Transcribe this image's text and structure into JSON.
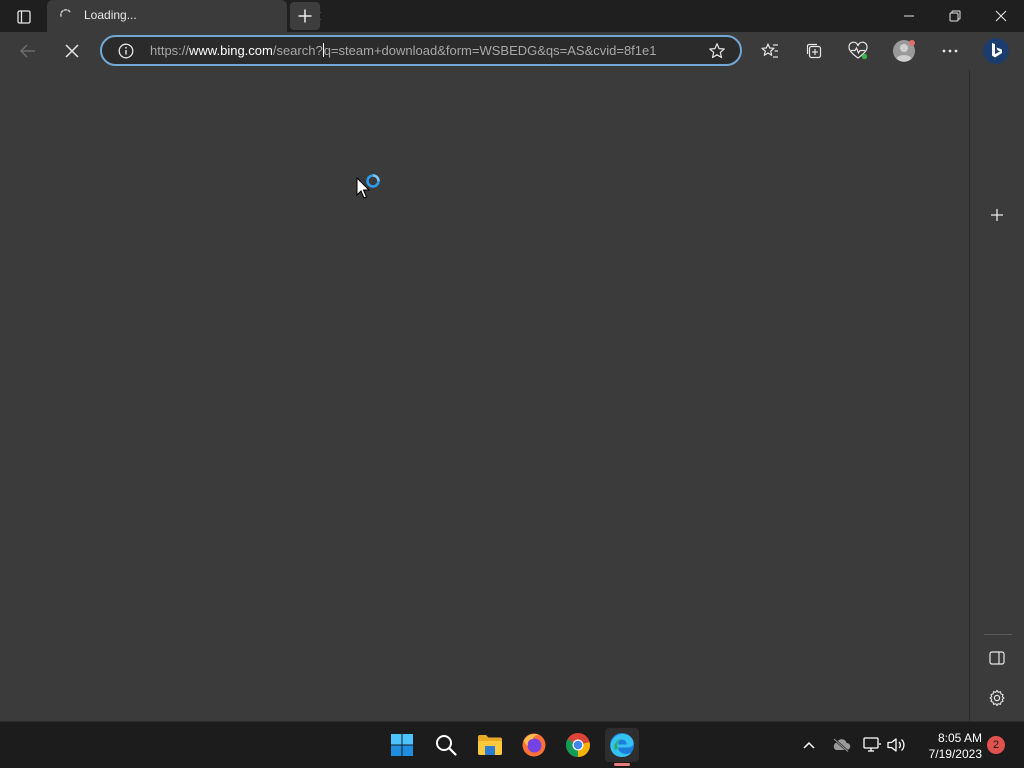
{
  "browser": {
    "tab": {
      "title": "Loading...",
      "state": "loading"
    },
    "address_bar": {
      "url_prefix": "https://",
      "url_host": "www.bing.com",
      "url_path_before_caret": "/search?",
      "url_path_after_caret": "q=steam+download&form=WSBEDG&qs=AS&cvid=8f1e1"
    },
    "toolbar_icons": [
      "back-icon",
      "stop-icon",
      "favorites-icon",
      "collections-icon",
      "browser-essentials-icon",
      "profile-icon",
      "more-icon",
      "bing-copilot-icon"
    ],
    "sidebar_icons": [
      "add-icon",
      "hide-sidebar-icon",
      "settings-icon"
    ]
  },
  "taskbar": {
    "apps": [
      "start-icon",
      "search-icon",
      "file-explorer-icon",
      "firefox-icon",
      "chrome-icon",
      "edge-icon"
    ],
    "active_app": "edge",
    "tray_icons": [
      "chevron-up-icon",
      "onedrive-offline-icon",
      "network-icon",
      "volume-icon"
    ],
    "clock": {
      "time": "8:05 AM",
      "date": "7/19/2023"
    },
    "notifications": "2"
  },
  "colors": {
    "accent": "#73a7d6",
    "chrome_bg": "#1f1f1f",
    "toolbar_bg": "#3b3b3b",
    "content_bg": "#3b3b3b",
    "taskbar_bg": "#1c1c1c",
    "notification_badge": "#e0524e"
  }
}
